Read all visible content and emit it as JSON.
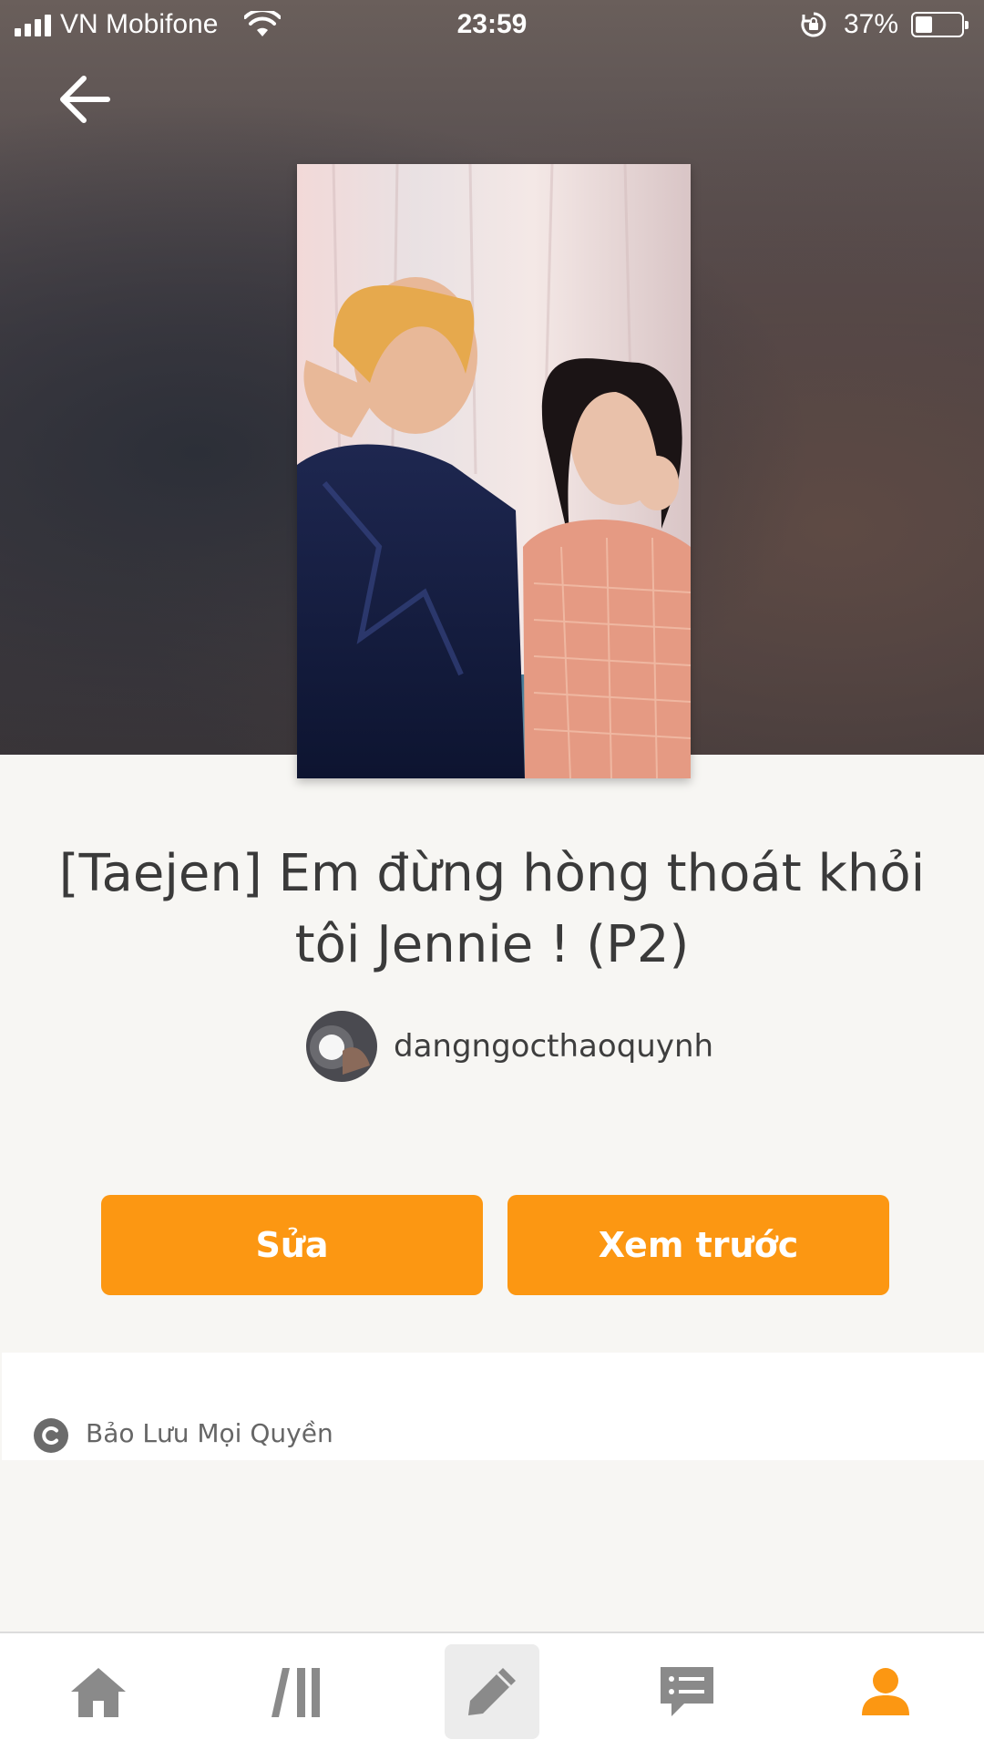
{
  "status_bar": {
    "carrier": "VN Mobifone",
    "time": "23:59",
    "battery_percent": "37%",
    "battery_level": 0.37
  },
  "story": {
    "title": "[Taejen] Em đừng hòng thoát khỏi tôi Jennie ! (P2)",
    "author": "dangngocthaoquynh"
  },
  "actions": {
    "edit_label": "Sửa",
    "preview_label": "Xem trước"
  },
  "copyright": {
    "label": "Bảo Lưu Mọi Quyền"
  },
  "tabbar": {
    "items": [
      {
        "name": "home",
        "icon": "home-icon"
      },
      {
        "name": "library",
        "icon": "library-icon"
      },
      {
        "name": "write",
        "icon": "pencil-icon"
      },
      {
        "name": "messages",
        "icon": "chat-icon"
      },
      {
        "name": "profile",
        "icon": "person-icon"
      }
    ]
  },
  "colors": {
    "accent": "#fc9712",
    "icon_inactive": "#8a8a8a",
    "background": "#f7f6f3"
  }
}
